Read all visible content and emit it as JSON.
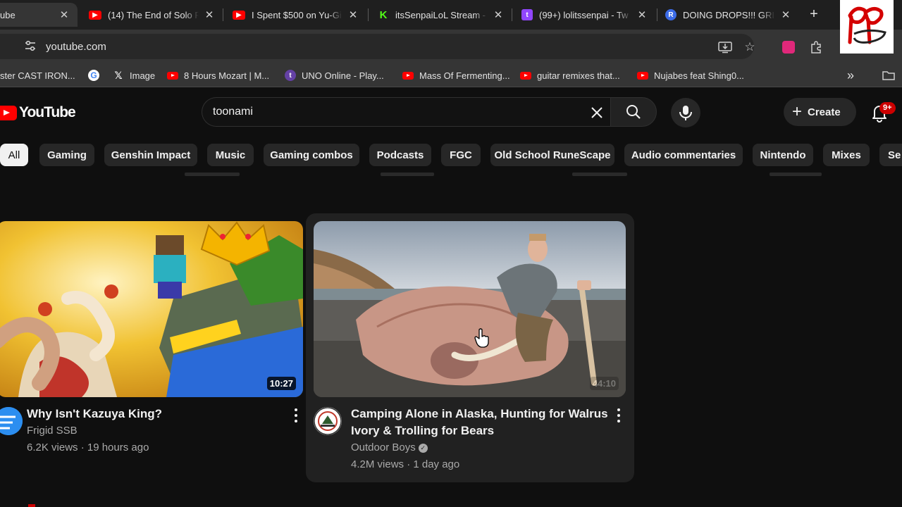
{
  "browser": {
    "tabs": [
      {
        "title": "ube",
        "active": true
      },
      {
        "title": "(14) The End of Solo R",
        "active": false
      },
      {
        "title": "I Spent $500 on Yu-Gi",
        "active": false
      },
      {
        "title": "itsSenpaiLoL Stream -",
        "active": false
      },
      {
        "title": "(99+) lolitssenpai - Tw",
        "active": false
      },
      {
        "title": "DOING DROPS!!! GRIN",
        "active": false
      }
    ],
    "url": "youtube.com",
    "bookmarks": [
      {
        "label": "ster CAST IRON..."
      },
      {
        "label": ""
      },
      {
        "label": "Image"
      },
      {
        "label": "8 Hours Mozart | M..."
      },
      {
        "label": "UNO Online - Play..."
      },
      {
        "label": "Mass Of Fermenting..."
      },
      {
        "label": "guitar remixes that..."
      },
      {
        "label": "Nujabes feat Shing0..."
      }
    ],
    "more_label": "»"
  },
  "youtube": {
    "logo_text": "YouTube",
    "search": {
      "value": "toonami"
    },
    "create_label": "Create",
    "notification_count": "9+",
    "chips": [
      "All",
      "Gaming",
      "Genshin Impact",
      "Music",
      "Gaming combos",
      "Podcasts",
      "FGC",
      "Old School RuneScape",
      "Audio commentaries",
      "Nintendo",
      "Mixes",
      "Se"
    ],
    "selected_chip": "All"
  },
  "videos": [
    {
      "title": "Why Isn't Kazuya King?",
      "channel": "Frigid SSB",
      "meta": "6.2K views · 19 hours ago",
      "duration": "10:27"
    },
    {
      "title": "Camping Alone in Alaska, Hunting for Walrus Ivory & Trolling for Bears",
      "channel": "Outdoor Boys",
      "meta": "4.2M views · 1 day ago",
      "duration": "44:10",
      "verified": true
    }
  ],
  "colors": {
    "youtube_red": "#ff0000",
    "background": "#0f0f0f",
    "chip": "#272727",
    "hover_card": "#212121"
  }
}
